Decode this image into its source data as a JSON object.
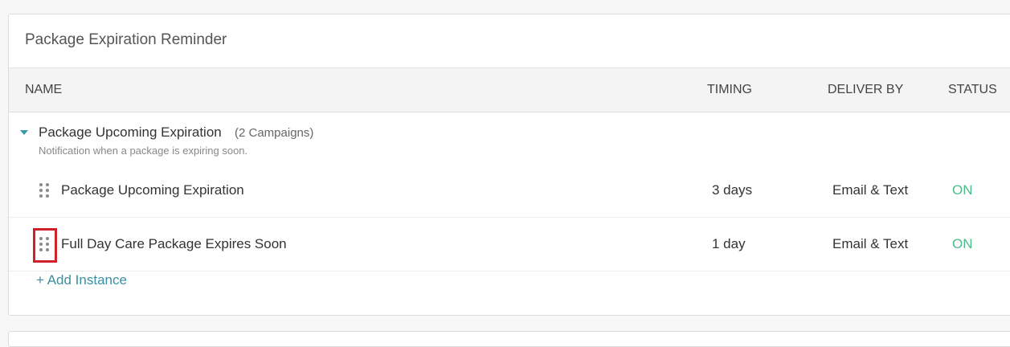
{
  "panel": {
    "title": "Package Expiration Reminder"
  },
  "table": {
    "headers": {
      "name": "NAME",
      "timing": "TIMING",
      "deliver_by": "DELIVER BY",
      "status": "STATUS"
    },
    "group": {
      "name": "Package Upcoming Expiration",
      "count": "(2 Campaigns)",
      "description": "Notification when a package is expiring soon."
    },
    "rows": [
      {
        "name": "Package Upcoming Expiration",
        "timing": "3 days",
        "deliver_by": "Email & Text",
        "status": "ON"
      },
      {
        "name": "Full Day Care Package Expires Soon",
        "timing": "1 day",
        "deliver_by": "Email & Text",
        "status": "ON"
      }
    ],
    "add_instance": "+ Add Instance"
  },
  "colors": {
    "accent": "#3a99a8",
    "status_on": "#4cbb8e",
    "highlight": "#d0202a"
  }
}
